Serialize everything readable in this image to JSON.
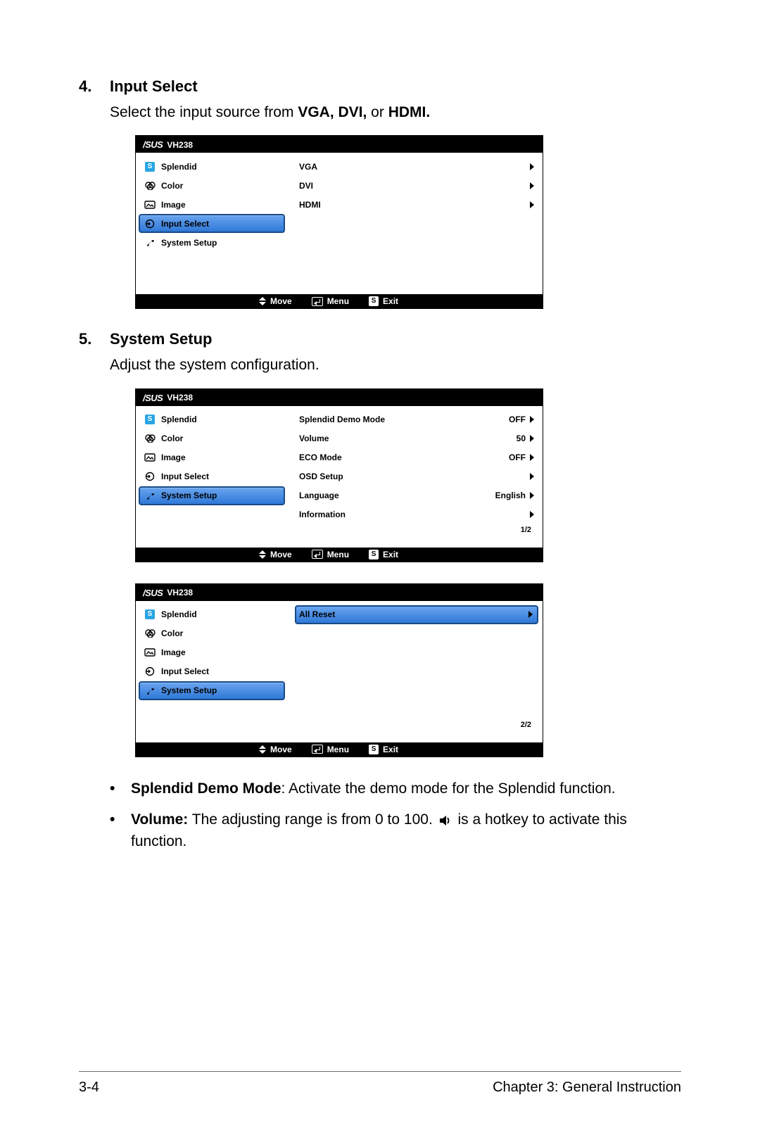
{
  "section4": {
    "num": "4.",
    "title": "Input Select",
    "desc_plain": "Select the input source from ",
    "desc_bold": "VGA, DVI,",
    "desc_mid": " or ",
    "desc_bold2": "HDMI."
  },
  "section5": {
    "num": "5.",
    "title": "System Setup",
    "desc": "Adjust the system configuration."
  },
  "osd_common": {
    "brand": "/SUS",
    "model": "VH238",
    "footer": {
      "move": "Move",
      "menu": "Menu",
      "exit": "Exit",
      "exit_key": "S"
    },
    "left_items": [
      {
        "label": "Splendid"
      },
      {
        "label": "Color"
      },
      {
        "label": "Image"
      },
      {
        "label": "Input Select"
      },
      {
        "label": "System Setup"
      }
    ]
  },
  "osd1": {
    "selected_left_index": 3,
    "right": [
      {
        "label": "VGA",
        "value": ""
      },
      {
        "label": "DVI",
        "value": ""
      },
      {
        "label": "HDMI",
        "value": ""
      }
    ]
  },
  "osd2": {
    "selected_left_index": 4,
    "page": "1/2",
    "right": [
      {
        "label": "Splendid Demo Mode",
        "value": "OFF"
      },
      {
        "label": "Volume",
        "value": "50"
      },
      {
        "label": "ECO Mode",
        "value": "OFF"
      },
      {
        "label": "OSD Setup",
        "value": ""
      },
      {
        "label": "Language",
        "value": "English"
      },
      {
        "label": "Information",
        "value": ""
      }
    ]
  },
  "osd3": {
    "selected_left_index": 4,
    "selected_right_index": 0,
    "page": "2/2",
    "right": [
      {
        "label": "All Reset",
        "value": ""
      }
    ]
  },
  "bullets": {
    "b1_strong": "Splendid Demo Mode",
    "b1_rest": ": Activate the demo mode for the Splendid function.",
    "b2_strong": "Volume:",
    "b2_part1": " The adjusting range is from 0 to 100. ",
    "b2_part2": " is a hotkey to activate this function."
  },
  "footer": {
    "left": "3-4",
    "right": "Chapter 3: General Instruction"
  }
}
